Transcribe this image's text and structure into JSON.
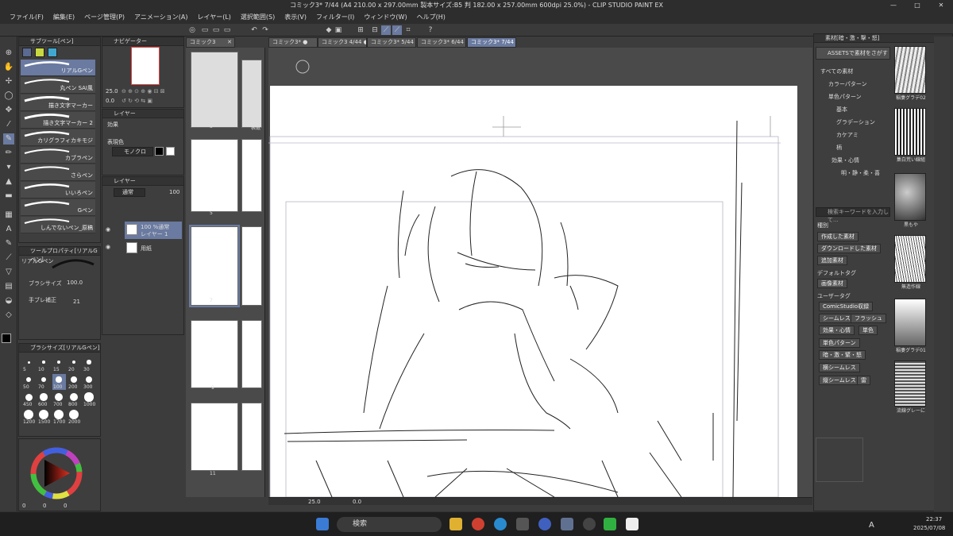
{
  "window": {
    "title": "コミック3* 7/44 (A4 210.00 x 297.00mm 製本サイズ:B5 判 182.00 x 257.00mm 600dpi 25.0%) - CLIP STUDIO PAINT EX",
    "minimize": "—",
    "maximize": "□",
    "close": "✕"
  },
  "menu": [
    "ファイル(F)",
    "編集(E)",
    "ページ管理(P)",
    "アニメーション(A)",
    "レイヤー(L)",
    "選択範囲(S)",
    "表示(V)",
    "フィルター(I)",
    "ウィンドウ(W)",
    "ヘルプ(H)"
  ],
  "doc_tabs": [
    "コミック3*",
    "コミック3*",
    "コミック3",
    "4/44",
    "コミック3*",
    "5/44",
    "コミック3*",
    "6/44",
    "コミック3*",
    "7/44"
  ],
  "page_panel_tab": "コミック3",
  "subtool": {
    "title": "サブツール[ペン]",
    "brushes": [
      "リアルGペン",
      "丸ペン SAI風",
      "描き文字マーカー",
      "描き文字マーカー 2",
      "カリグラフィカキモジ",
      "カブラペン",
      "さらペン",
      "いいろペン",
      "Gペン",
      "しんでないペン_原稿"
    ]
  },
  "navigator": {
    "title": "ナビゲーター",
    "zoom": "25.0",
    "angle": "0.0"
  },
  "layer_property": {
    "title": "レイヤー",
    "effect": "効果",
    "expression": "表現色",
    "mode": "モノクロ"
  },
  "layers": {
    "title": "レイヤー",
    "blend": "通常",
    "opacity": "100",
    "items": [
      {
        "line1": "100 %通常",
        "line2": "レイヤー 1"
      },
      {
        "line1": "",
        "line2": "用紙"
      }
    ]
  },
  "tool_property": {
    "title": "ツールプロパティ[リアルGペン]",
    "name": "リアルGペン",
    "size_label": "ブラシサイズ",
    "size_value": "100.0",
    "stab_label": "手ブレ補正",
    "stab_value": "21"
  },
  "brush_size": {
    "title": "ブラシサイズ[リアルGペン]",
    "sizes": [
      "5",
      "10",
      "15",
      "20",
      "30",
      "50",
      "70",
      "100",
      "200",
      "300",
      "450",
      "600",
      "700",
      "800",
      "1000",
      "1200",
      "1500",
      "1700",
      "2000"
    ]
  },
  "color": {
    "fg": "#000000",
    "bg": "#ffffff",
    "values": [
      "0",
      "0",
      "0"
    ]
  },
  "pages": {
    "labels": [
      "3",
      "表紙",
      "5",
      "7",
      "9",
      "11"
    ]
  },
  "canvas_status": {
    "zoom": "25.0",
    "angle": "0.0"
  },
  "materials": {
    "title": "素材[暗・激・撃・怒]",
    "search_assets": "ASSETSで素材をさがす",
    "tree": [
      "すべての素材",
      "カラーパターン",
      "単色パターン",
      "基本",
      "グラデーション",
      "カケアミ",
      "柄",
      "効果・心情",
      "明・静・柔・喜"
    ],
    "search_placeholder": "検索キーワードを入力して...",
    "type_label": "種別",
    "type_tags": [
      "作成した素材",
      "ダウンロードした素材",
      "追加素材"
    ],
    "default_tag_label": "デフォルトタグ",
    "default_tags": [
      "画像素材"
    ],
    "user_tag_label": "ユーザータグ",
    "user_tags": [
      "ComicStudio収録",
      "シームレス",
      "フラッシュ",
      "効果・心情",
      "単色",
      "単色パターン",
      "暗・激・緊・怒",
      "横シームレス",
      "縦シームレス",
      "雷"
    ],
    "thumbs": [
      "稲妻グラデ02",
      "集白荒い線組",
      "黒もや",
      "無造作線",
      "稲妻グラデ01",
      "流線グレーに"
    ]
  },
  "taskbar": {
    "search": "検索",
    "time": "22:37",
    "date": "2025/07/08",
    "ime": "A"
  }
}
